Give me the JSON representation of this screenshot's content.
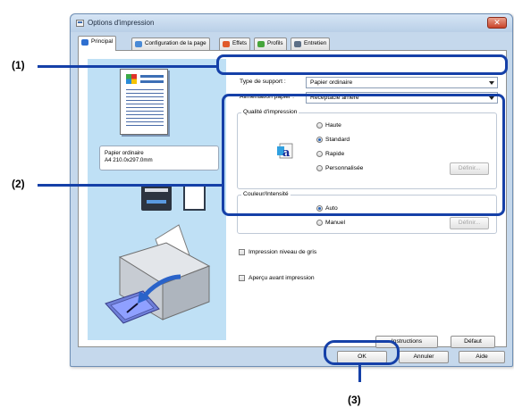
{
  "window": {
    "title": "Options d'impression",
    "close_label": "✕"
  },
  "tabs": [
    {
      "label": "Principal",
      "icon": "main-tab-icon",
      "color": "#2e6fd0"
    },
    {
      "label": "Configuration de la page",
      "icon": "page-setup-tab-icon",
      "color": "#4a8ad6"
    },
    {
      "label": "Effets",
      "icon": "effects-tab-icon",
      "color": "#e05a2a"
    },
    {
      "label": "Profils",
      "icon": "profiles-tab-icon",
      "color": "#46a53b"
    },
    {
      "label": "Entretien",
      "icon": "maintenance-tab-icon",
      "color": "#5d6f86"
    }
  ],
  "preview": {
    "media_name": "Papier ordinaire",
    "media_size": "A4 210.0x297.0mm"
  },
  "media": {
    "type_label": "Type de support :",
    "type_value": "Papier ordinaire",
    "source_label": "Alimentation papier :",
    "source_value": "Réceptacle arrière"
  },
  "quality": {
    "title": "Qualité d'impression",
    "options": [
      "Haute",
      "Standard",
      "Rapide",
      "Personnalisée"
    ],
    "selected": "Standard",
    "define_label": "Définir..."
  },
  "color": {
    "title": "Couleur/Intensité",
    "options": [
      "Auto",
      "Manuel"
    ],
    "selected": "Auto",
    "define_label": "Définir..."
  },
  "checkboxes": {
    "grayscale": "Impression niveau de gris",
    "preview_before": "Aperçu avant impression"
  },
  "buttons": {
    "instructions": "Instructions",
    "defaults": "Défaut",
    "ok": "OK",
    "cancel": "Annuler",
    "help": "Aide"
  },
  "callouts": {
    "one": "(1)",
    "two": "(2)",
    "three": "(3)",
    "color": "#1540a8"
  }
}
